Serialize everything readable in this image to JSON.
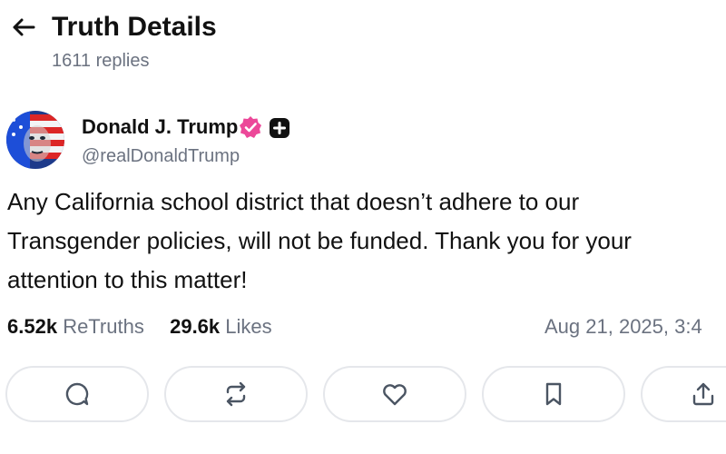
{
  "header": {
    "title": "Truth Details",
    "replies": "1611 replies",
    "back_icon": "arrow-left-icon"
  },
  "author": {
    "name": "Donald J. Trump",
    "handle": "@realDonaldTrump",
    "verified_icon": "verified-badge-icon",
    "plus_icon": "plus-badge-icon",
    "verified_color": "#ec4899"
  },
  "post": {
    "text": "Any California school district that doesn’t adhere to our\nTransgender policies, will not be funded. Thank you for your\nattention to this matter!"
  },
  "stats": {
    "retruths_count": "6.52k",
    "retruths_label": "ReTruths",
    "likes_count": "29.6k",
    "likes_label": "Likes",
    "timestamp": "Aug 21, 2025, 3:4"
  },
  "actions": [
    {
      "icon": "reply-icon"
    },
    {
      "icon": "retruth-icon"
    },
    {
      "icon": "like-icon"
    },
    {
      "icon": "bookmark-icon"
    },
    {
      "icon": "share-icon"
    }
  ]
}
